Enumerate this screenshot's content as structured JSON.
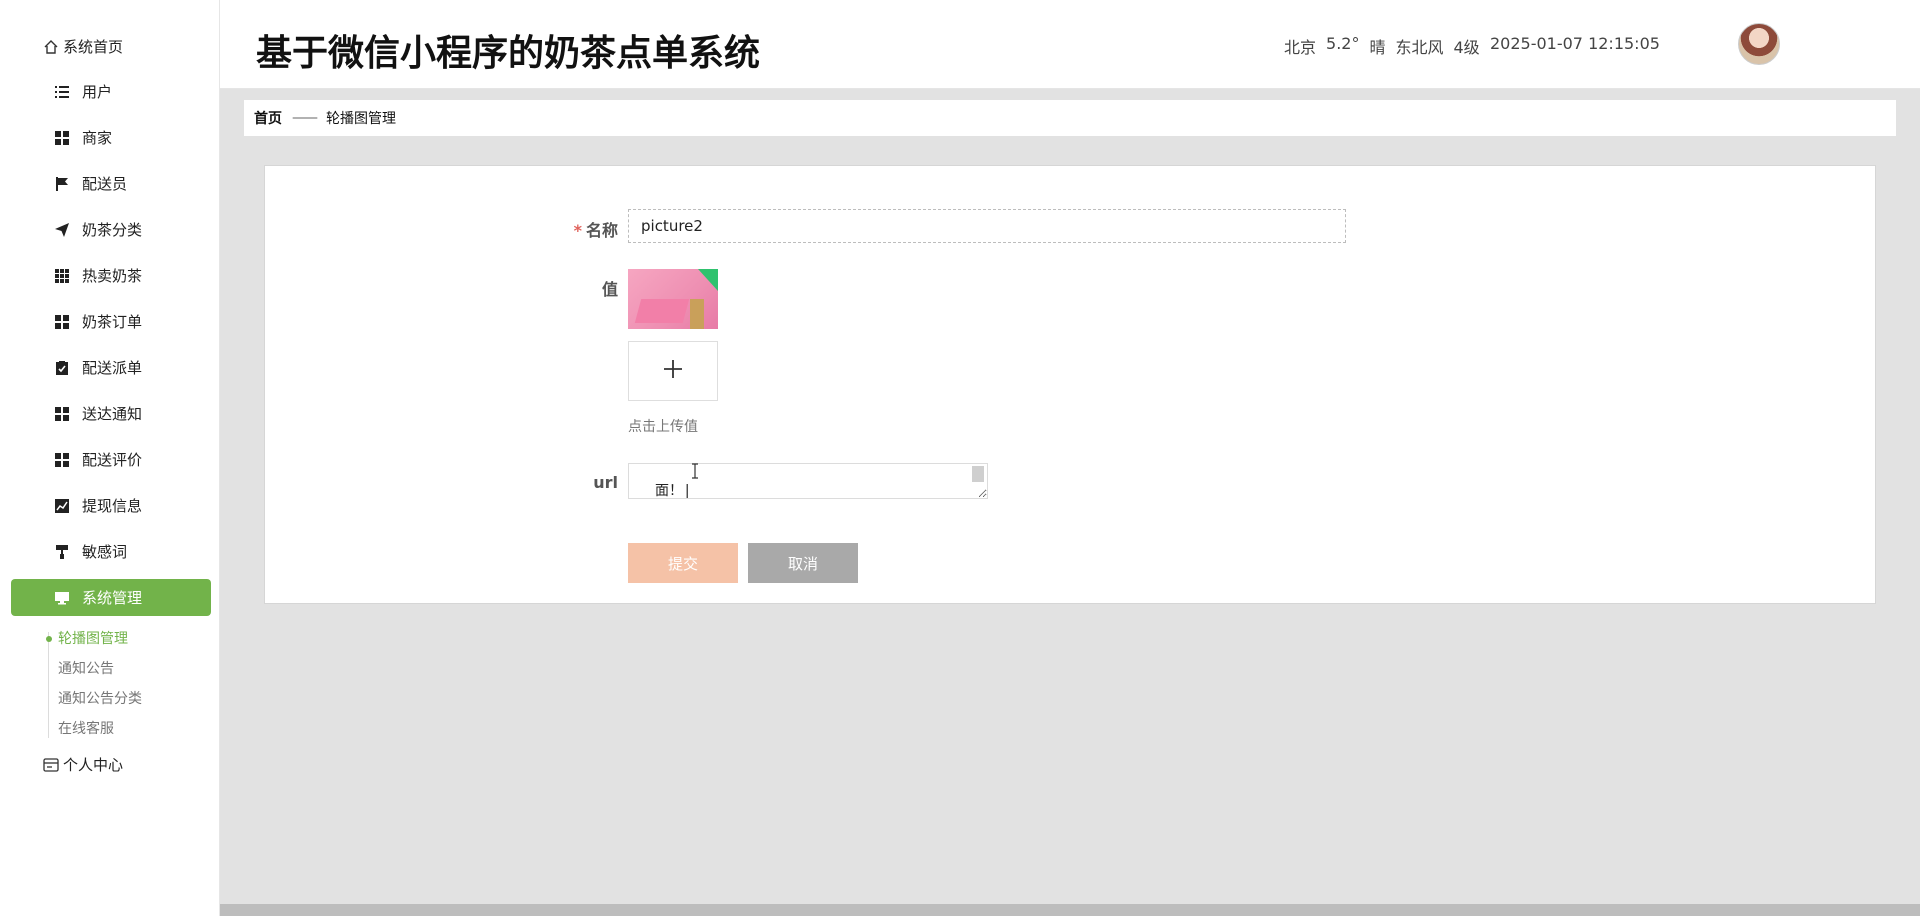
{
  "header": {
    "title": "基于微信小程序的奶茶点单系统",
    "weather": {
      "city": "北京",
      "temp": "5.2°",
      "condition": "晴",
      "wind": "东北风",
      "level": "4级"
    },
    "datetime": "2025-01-07 12:15:05"
  },
  "sidebar": {
    "home": "系统首页",
    "items": [
      "用户",
      "商家",
      "配送员",
      "奶茶分类",
      "热卖奶茶",
      "奶茶订单",
      "配送派单",
      "送达通知",
      "配送评价",
      "提现信息",
      "敏感词"
    ],
    "active": "系统管理",
    "submenu": [
      "轮播图管理",
      "通知公告",
      "通知公告分类",
      "在线客服"
    ],
    "personal": "个人中心"
  },
  "breadcrumb": {
    "home": "首页",
    "separator": "——",
    "current": "轮播图管理"
  },
  "form": {
    "name_label": "名称",
    "name_required": "*",
    "name_value": "picture2",
    "value_label": "值",
    "upload_tip": "点击上传值",
    "url_label": "url",
    "url_value": "面！|",
    "submit": "提交",
    "cancel": "取消"
  },
  "colors": {
    "accent": "#72b34a",
    "submit": "#f5c2a7",
    "cancel": "#a9a9a9",
    "required": "#e0625c"
  }
}
